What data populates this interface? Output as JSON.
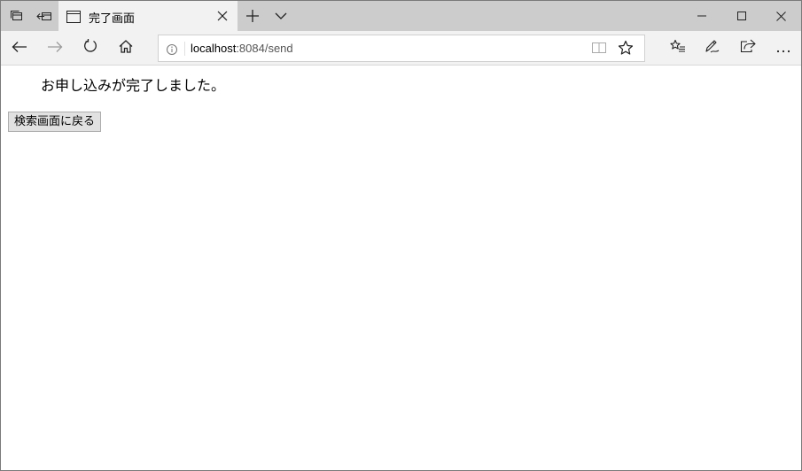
{
  "tab": {
    "title": "完了画面"
  },
  "address_bar": {
    "host": "localhost",
    "path": ":8084/send"
  },
  "page": {
    "message": "お申し込みが完了しました。",
    "back_button_label": "検索画面に戻る"
  },
  "icons": [
    "tab-overview-icon",
    "set-aside-tabs-icon",
    "page-icon",
    "close-tab-icon",
    "new-tab-icon",
    "tab-preview-chevron-icon",
    "minimize-icon",
    "maximize-icon",
    "close-icon",
    "back-icon",
    "forward-icon",
    "refresh-icon",
    "home-icon",
    "info-icon",
    "reading-view-icon",
    "favorite-star-icon",
    "favorites-hub-icon",
    "web-note-icon",
    "share-icon",
    "more-icon"
  ]
}
